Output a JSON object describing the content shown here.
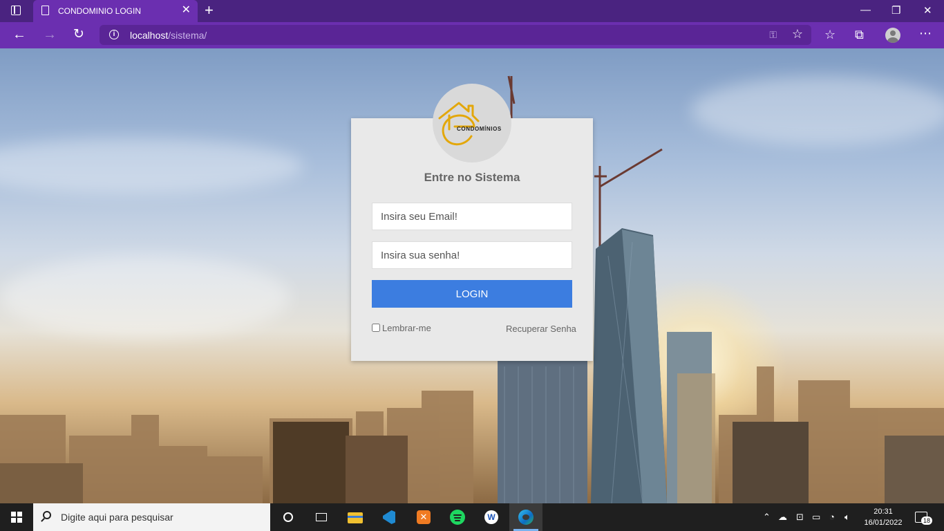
{
  "browser": {
    "tab_title": "CONDOMINIO LOGIN",
    "tab_close": "✕",
    "new_tab": "+",
    "url_host": "localhost",
    "url_path": "/sistema/",
    "minimize": "—",
    "restore": "❐",
    "close": "✕"
  },
  "login": {
    "logo_text": "CONDOMÍNIOS",
    "heading": "Entre no Sistema",
    "email_placeholder": "Insira seu Email!",
    "password_placeholder": "Insira sua senha!",
    "login_button": "LOGIN",
    "remember_label": "Lembrar-me",
    "recover_link": "Recuperar Senha"
  },
  "taskbar": {
    "search_placeholder": "Digite aqui para pesquisar",
    "time": "20:31",
    "date": "16/01/2022",
    "notification_count": "18"
  },
  "colors": {
    "chrome_dark": "#4a2380",
    "chrome": "#6b2fb0",
    "button": "#3c7de0",
    "logo_gold": "#e3a70a"
  }
}
